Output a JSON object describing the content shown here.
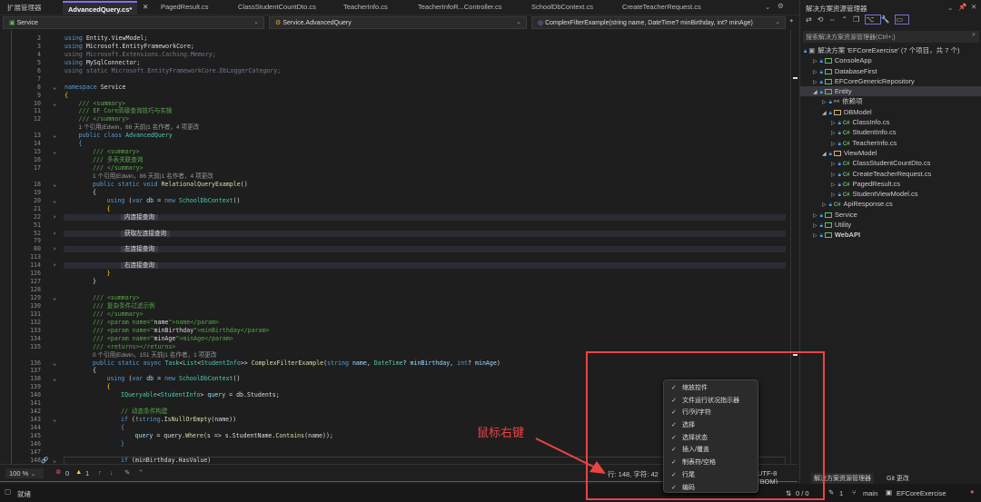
{
  "tabs": {
    "side_panel": "扩展管理器",
    "items": [
      "AdvancedQuery.cs*",
      "PagedResult.cs",
      "ClassStudentCountDto.cs",
      "TeacherInfo.cs",
      "TeacherInfoR...Controller.cs",
      "SchoolDbContext.cs",
      "CreateTeacherRequest.cs"
    ],
    "active": 0
  },
  "navbar": {
    "project": "Service",
    "type": "Service.AdvancedQuery",
    "member": "ComplexFilterExample(string name, DateTime? minBirthday, int? minAge)"
  },
  "code": [
    {
      "n": "2",
      "i": 1,
      "s": [
        [
          "kw",
          "using "
        ],
        [
          "id",
          "Entity.ViewModel;"
        ]
      ]
    },
    {
      "n": "3",
      "i": 1,
      "s": [
        [
          "kw",
          "using "
        ],
        [
          "id",
          "Microsoft.EntityFrameworkCore;"
        ]
      ]
    },
    {
      "n": "4",
      "i": 1,
      "s": [
        [
          "dim",
          "using Microsoft.Extensions.Caching.Memory;"
        ]
      ]
    },
    {
      "n": "5",
      "i": 1,
      "s": [
        [
          "kw",
          "using "
        ],
        [
          "id",
          "MySqlConnector;"
        ]
      ]
    },
    {
      "n": "6",
      "i": 1,
      "s": [
        [
          "dim",
          "using static Microsoft.EntityFrameworkCore.DbLoggerCategory;"
        ]
      ]
    },
    {
      "n": "7",
      "i": 1,
      "s": []
    },
    {
      "n": "8",
      "i": 1,
      "f": 1,
      "s": [
        [
          "kw",
          "namespace "
        ],
        [
          "id",
          "Service"
        ]
      ]
    },
    {
      "n": "9",
      "i": 1,
      "s": [
        [
          "br",
          "{"
        ]
      ]
    },
    {
      "n": "10",
      "i": 2,
      "f": 1,
      "s": [
        [
          "cm",
          "/// <summary>"
        ]
      ]
    },
    {
      "n": "11",
      "i": 2,
      "s": [
        [
          "cm",
          "/// EF Core高级查询技巧与实操"
        ]
      ]
    },
    {
      "n": "12",
      "i": 2,
      "s": [
        [
          "cm",
          "/// </summary>"
        ]
      ]
    },
    {
      "n": "",
      "i": 2,
      "s": [
        [
          "lens",
          "1 个引用|Edwin，86 天前|1 名作者，4 项更改"
        ]
      ]
    },
    {
      "n": "13",
      "i": 2,
      "f": 1,
      "s": [
        [
          "kw",
          "public class "
        ],
        [
          "ty",
          "AdvancedQuery"
        ]
      ]
    },
    {
      "n": "14",
      "i": 2,
      "s": [
        [
          "kw",
          "{"
        ]
      ]
    },
    {
      "n": "15",
      "i": 3,
      "f": 1,
      "s": [
        [
          "cm",
          "/// <summary>"
        ]
      ]
    },
    {
      "n": "16",
      "i": 3,
      "s": [
        [
          "cm",
          "/// 多表关联查询"
        ]
      ]
    },
    {
      "n": "17",
      "i": 3,
      "s": [
        [
          "cm",
          "/// </summary>"
        ]
      ]
    },
    {
      "n": "",
      "i": 3,
      "s": [
        [
          "lens",
          "1 个引用|Edwin，86 天前|1 名作者，4 项更改"
        ]
      ]
    },
    {
      "n": "18",
      "i": 3,
      "f": 1,
      "s": [
        [
          "kw",
          "public static void "
        ],
        [
          "mt",
          "RelationalQueryExample"
        ],
        [
          "id",
          "()"
        ]
      ]
    },
    {
      "n": "19",
      "i": 3,
      "s": [
        [
          "id",
          "{"
        ]
      ]
    },
    {
      "n": "20",
      "i": 4,
      "f": 1,
      "s": [
        [
          "kw",
          "using "
        ],
        [
          "id",
          "("
        ],
        [
          "kw",
          "var "
        ],
        [
          "pr",
          "db"
        ],
        [
          "id",
          " = "
        ],
        [
          "kw",
          "new "
        ],
        [
          "ty",
          "SchoolDbContext"
        ],
        [
          "id",
          "()"
        ]
      ]
    },
    {
      "n": "21",
      "i": 4,
      "s": [
        [
          "br",
          "{"
        ]
      ]
    },
    {
      "n": "22",
      "i": 5,
      "f": 2,
      "c": 1,
      "s": [
        [
          "hint",
          "内连接查询"
        ]
      ]
    },
    {
      "n": "51",
      "i": 5,
      "s": []
    },
    {
      "n": "52",
      "i": 5,
      "f": 2,
      "c": 1,
      "s": [
        [
          "hint",
          "获取左连接查询"
        ]
      ]
    },
    {
      "n": "79",
      "i": 5,
      "s": []
    },
    {
      "n": "80",
      "i": 5,
      "f": 2,
      "c": 1,
      "s": [
        [
          "hint",
          "左连接查询"
        ]
      ]
    },
    {
      "n": "113",
      "i": 5,
      "s": []
    },
    {
      "n": "114",
      "i": 5,
      "f": 2,
      "c": 1,
      "s": [
        [
          "hint",
          "右连接查询"
        ]
      ]
    },
    {
      "n": "126",
      "i": 4,
      "s": [
        [
          "br",
          "}"
        ]
      ]
    },
    {
      "n": "127",
      "i": 3,
      "s": [
        [
          "id",
          "}"
        ]
      ]
    },
    {
      "n": "128",
      "i": 3,
      "s": []
    },
    {
      "n": "129",
      "i": 3,
      "f": 1,
      "s": [
        [
          "cm",
          "/// <summary>"
        ]
      ]
    },
    {
      "n": "130",
      "i": 3,
      "s": [
        [
          "cm",
          "/// 复杂条件过滤示例"
        ]
      ]
    },
    {
      "n": "131",
      "i": 3,
      "s": [
        [
          "cm",
          "/// </summary>"
        ]
      ]
    },
    {
      "n": "132",
      "i": 3,
      "s": [
        [
          "cm",
          "/// <param name=\""
        ],
        [
          "id",
          "name"
        ],
        [
          "cm",
          "\">name</param>"
        ]
      ]
    },
    {
      "n": "133",
      "i": 3,
      "s": [
        [
          "cm",
          "/// <param name=\""
        ],
        [
          "id",
          "minBirthday"
        ],
        [
          "cm",
          "\">minBirthday</param>"
        ]
      ]
    },
    {
      "n": "134",
      "i": 3,
      "s": [
        [
          "cm",
          "/// <param name=\""
        ],
        [
          "id",
          "minAge"
        ],
        [
          "cm",
          "\">minAge</param>"
        ]
      ]
    },
    {
      "n": "135",
      "i": 3,
      "s": [
        [
          "cm",
          "/// <returns></returns>"
        ]
      ]
    },
    {
      "n": "",
      "i": 3,
      "s": [
        [
          "lens",
          "0 个引用|Edwin，151 天前|1 名作者，1 项更改"
        ]
      ]
    },
    {
      "n": "136",
      "i": 3,
      "f": 1,
      "s": [
        [
          "kw",
          "public static async "
        ],
        [
          "ty",
          "Task"
        ],
        [
          "id",
          "<"
        ],
        [
          "ty",
          "List"
        ],
        [
          "id",
          "<"
        ],
        [
          "ty",
          "StudentInfo"
        ],
        [
          "id",
          ">> "
        ],
        [
          "mt",
          "ComplexFilterExample"
        ],
        [
          "id",
          "("
        ],
        [
          "kw",
          "string "
        ],
        [
          "pr",
          "name"
        ],
        [
          "id",
          ", "
        ],
        [
          "ty",
          "DateTime"
        ],
        [
          "id",
          "? "
        ],
        [
          "pr",
          "minBirthday"
        ],
        [
          "id",
          ", "
        ],
        [
          "kw",
          "int"
        ],
        [
          "id",
          "? "
        ],
        [
          "pr",
          "minAge"
        ],
        [
          "id",
          ")"
        ]
      ]
    },
    {
      "n": "137",
      "i": 3,
      "s": [
        [
          "id",
          "{"
        ]
      ]
    },
    {
      "n": "138",
      "i": 4,
      "f": 1,
      "s": [
        [
          "kw",
          "using "
        ],
        [
          "id",
          "("
        ],
        [
          "kw",
          "var "
        ],
        [
          "pr",
          "db"
        ],
        [
          "id",
          " = "
        ],
        [
          "kw",
          "new "
        ],
        [
          "ty",
          "SchoolDbContext"
        ],
        [
          "id",
          "()"
        ]
      ]
    },
    {
      "n": "139",
      "i": 4,
      "s": [
        [
          "br",
          "{"
        ]
      ]
    },
    {
      "n": "140",
      "i": 5,
      "s": [
        [
          "ty",
          "IQueryable"
        ],
        [
          "id",
          "<"
        ],
        [
          "ty",
          "StudentInfo"
        ],
        [
          "id",
          "> "
        ],
        [
          "pr",
          "query"
        ],
        [
          "id",
          " = db.Students;"
        ]
      ]
    },
    {
      "n": "141",
      "i": 5,
      "s": []
    },
    {
      "n": "142",
      "i": 5,
      "s": [
        [
          "cm",
          "// 动态条件构建"
        ]
      ]
    },
    {
      "n": "143",
      "i": 5,
      "f": 1,
      "s": [
        [
          "kw",
          "if "
        ],
        [
          "id",
          "(!"
        ],
        [
          "kw",
          "string"
        ],
        [
          "id",
          "."
        ],
        [
          "mt",
          "IsNullOrEmpty"
        ],
        [
          "id",
          "(name))"
        ]
      ]
    },
    {
      "n": "144",
      "i": 5,
      "s": [
        [
          "kw",
          "{"
        ]
      ]
    },
    {
      "n": "145",
      "i": 6,
      "s": [
        [
          "pr",
          "query"
        ],
        [
          "id",
          " = query."
        ],
        [
          "mt",
          "Where"
        ],
        [
          "id",
          "(s => s.StudentName."
        ],
        [
          "mt",
          "Contains"
        ],
        [
          "id",
          "(name));"
        ]
      ]
    },
    {
      "n": "146",
      "i": 5,
      "s": [
        [
          "kw",
          "}"
        ]
      ]
    },
    {
      "n": "147",
      "i": 5,
      "s": []
    },
    {
      "n": "148",
      "i": 5,
      "f": 1,
      "cur": 1,
      "s": [
        [
          "kw",
          "if "
        ],
        [
          "id",
          "(minBirthday.HasValue)"
        ]
      ]
    }
  ],
  "editor_status": {
    "zoom": "100 %",
    "errors": "0",
    "warnings": "1",
    "position": "行: 148, 字符: 42",
    "encoding": "UTF-8 (BOM)"
  },
  "context_menu": {
    "items": [
      {
        "label": "缩放控件",
        "checked": true
      },
      {
        "label": "文件运行状况指示器",
        "checked": true
      },
      {
        "label": "行/列/字符",
        "checked": true
      },
      {
        "label": "选择",
        "checked": true
      },
      {
        "label": "选择状态",
        "checked": true
      },
      {
        "label": "插入/覆盖",
        "checked": true
      },
      {
        "label": "制表符/空格",
        "checked": true
      },
      {
        "label": "行尾",
        "checked": true
      },
      {
        "label": "编码",
        "checked": true
      }
    ]
  },
  "annotation": {
    "label": "鼠标右键",
    "color": "#e84545"
  },
  "solution_explorer": {
    "title": "解决方案资源管理器",
    "search_placeholder": "搜索解决方案资源管理器(Ctrl+;)",
    "tree": [
      {
        "label": "解决方案 'EFCoreExercise' (7 个项目，共 7 个)",
        "depth": 0,
        "icon": "solution-icon",
        "exp": ""
      },
      {
        "label": "ConsoleApp",
        "depth": 1,
        "icon": "project-icon",
        "exp": "▷"
      },
      {
        "label": "DatabaseFirst",
        "depth": 1,
        "icon": "project-icon",
        "exp": "▷"
      },
      {
        "label": "EFCoreGenericRepository",
        "depth": 1,
        "icon": "project-icon",
        "exp": "▷"
      },
      {
        "label": "Entity",
        "depth": 1,
        "icon": "project-icon",
        "exp": "◢",
        "selected": true
      },
      {
        "label": "依赖项",
        "depth": 2,
        "icon": "dependencies-icon",
        "exp": "▷"
      },
      {
        "label": "DBModel",
        "depth": 2,
        "icon": "folder-icon",
        "exp": "◢"
      },
      {
        "label": "ClassInfo.cs",
        "depth": 3,
        "icon": "csharp-file-icon",
        "exp": "▷"
      },
      {
        "label": "StudentInfo.cs",
        "depth": 3,
        "icon": "csharp-file-icon",
        "exp": "▷"
      },
      {
        "label": "TeacherInfo.cs",
        "depth": 3,
        "icon": "csharp-file-icon",
        "exp": "▷"
      },
      {
        "label": "ViewModel",
        "depth": 2,
        "icon": "folder-icon",
        "exp": "◢"
      },
      {
        "label": "ClassStudentCountDto.cs",
        "depth": 3,
        "icon": "csharp-file-icon",
        "exp": "▷"
      },
      {
        "label": "CreateTeacherRequest.cs",
        "depth": 3,
        "icon": "csharp-file-icon",
        "exp": "▷"
      },
      {
        "label": "PagedResult.cs",
        "depth": 3,
        "icon": "csharp-file-icon",
        "exp": "▷"
      },
      {
        "label": "StudentViewModel.cs",
        "depth": 3,
        "icon": "csharp-file-icon",
        "exp": "▷"
      },
      {
        "label": "ApiResponse.cs",
        "depth": 2,
        "icon": "csharp-file-icon",
        "exp": "▷"
      },
      {
        "label": "Service",
        "depth": 1,
        "icon": "project-icon",
        "exp": "▷"
      },
      {
        "label": "Utility",
        "depth": 1,
        "icon": "project-icon",
        "exp": "▷"
      },
      {
        "label": "WebAPI",
        "depth": 1,
        "icon": "project-icon",
        "exp": "▷",
        "bold": true
      }
    ],
    "bottom_tabs": [
      "解决方案资源管理器",
      "Git 更改"
    ]
  },
  "statusbar": {
    "ready": "就绪",
    "sync": "0 / 0",
    "edits": "1",
    "branch": "main",
    "repo": "EFCoreExercise"
  }
}
